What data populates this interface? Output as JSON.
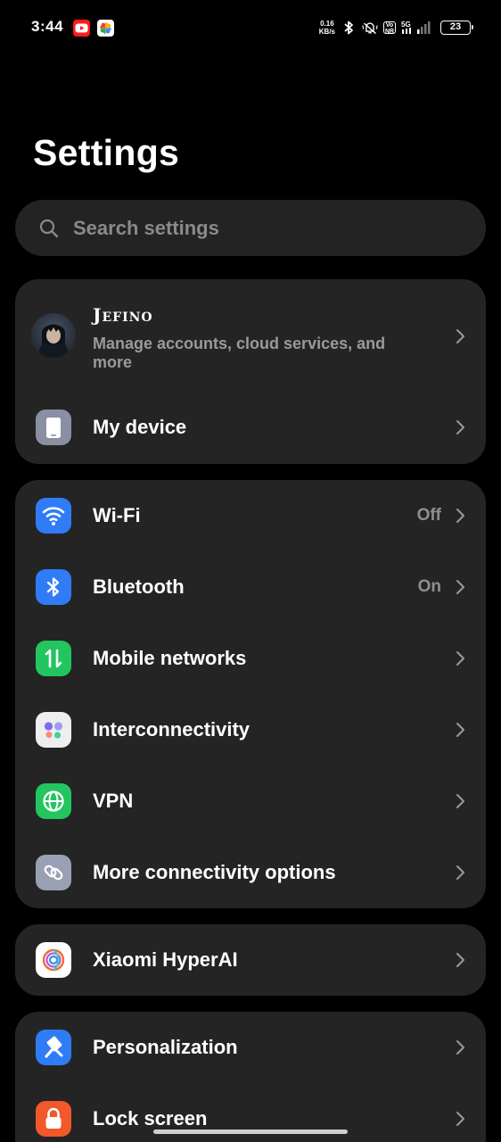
{
  "status_bar": {
    "time": "3:44",
    "net_speed_value": "0.16",
    "net_speed_unit": "KB/s",
    "vo_label_top": "Vo",
    "vo_label_bottom": "NR",
    "network_type": "5G",
    "battery": "23"
  },
  "header": {
    "title": "Settings"
  },
  "search": {
    "placeholder": "Search settings"
  },
  "account_card": {
    "name": "Jefino",
    "subtitle": "Manage accounts, cloud services, and more",
    "my_device_label": "My device"
  },
  "connectivity_card": {
    "items": [
      {
        "label": "Wi-Fi",
        "value": "Off",
        "icon": "wifi-icon",
        "color": "#2f7cf6"
      },
      {
        "label": "Bluetooth",
        "value": "On",
        "icon": "bluetooth-icon",
        "color": "#2f7cf6"
      },
      {
        "label": "Mobile networks",
        "value": "",
        "icon": "mobile-data-icon",
        "color": "#22c55e"
      },
      {
        "label": "Interconnectivity",
        "value": "",
        "icon": "interconnectivity-icon",
        "color": "#eeeeee"
      },
      {
        "label": "VPN",
        "value": "",
        "icon": "globe-icon",
        "color": "#22c55e"
      },
      {
        "label": "More connectivity options",
        "value": "",
        "icon": "link-icon",
        "color": "#9aa0b4"
      }
    ]
  },
  "ai_card": {
    "label": "Xiaomi HyperAI",
    "icon": "hyperai-icon"
  },
  "personal_card": {
    "items": [
      {
        "label": "Personalization",
        "icon": "brush-icon",
        "color": "#2f7cf6"
      },
      {
        "label": "Lock screen",
        "icon": "lock-icon",
        "color": "#f2582a"
      }
    ]
  }
}
